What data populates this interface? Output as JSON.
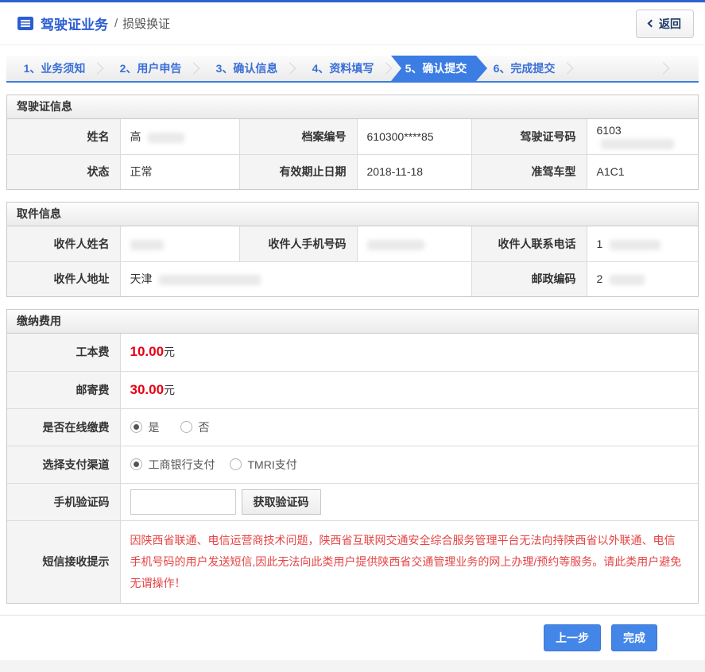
{
  "header": {
    "title": "驾驶证业务",
    "divider": "/",
    "subtitle": "损毁换证",
    "back_button": {
      "label": "返回"
    }
  },
  "steps": {
    "items": [
      {
        "label": "1、业务须知",
        "active": false
      },
      {
        "label": "2、用户申告",
        "active": false
      },
      {
        "label": "3、确认信息",
        "active": false
      },
      {
        "label": "4、资料填写",
        "active": false
      },
      {
        "label": "5、确认提交",
        "active": true
      },
      {
        "label": "6、完成提交",
        "active": false
      }
    ]
  },
  "license_section": {
    "title": "驾驶证信息",
    "fields": {
      "name": {
        "label": "姓名",
        "value": "高",
        "redacted": true
      },
      "file_no": {
        "label": "档案编号",
        "value": "610300****85",
        "redacted": false
      },
      "license_no": {
        "label": "驾驶证号码",
        "value": "6103",
        "redacted": true
      },
      "status": {
        "label": "状态",
        "value": "正常",
        "redacted": false
      },
      "valid_until": {
        "label": "有效期止日期",
        "value": "2018-11-18",
        "redacted": false
      },
      "vehicle_class": {
        "label": "准驾车型",
        "value": "A1C1",
        "redacted": false
      }
    }
  },
  "pickup_section": {
    "title": "取件信息",
    "fields": {
      "recipient_name": {
        "label": "收件人姓名",
        "value": "",
        "redacted": true
      },
      "recipient_mobile": {
        "label": "收件人手机号码",
        "value": "",
        "redacted": true
      },
      "recipient_phone": {
        "label": "收件人联系电话",
        "value": "1",
        "redacted": true
      },
      "recipient_address": {
        "label": "收件人地址",
        "value": "天津",
        "redacted": true
      },
      "postal_code": {
        "label": "邮政编码",
        "value": "2",
        "redacted": true
      }
    }
  },
  "payment_section": {
    "title": "缴纳费用",
    "fee_unit": "元",
    "rows": {
      "production_fee": {
        "label": "工本费",
        "amount": "10.00"
      },
      "postage_fee": {
        "label": "邮寄费",
        "amount": "30.00"
      },
      "online_payment": {
        "label": "是否在线缴费",
        "options": [
          {
            "label": "是",
            "selected": true
          },
          {
            "label": "否",
            "selected": false
          }
        ]
      },
      "payment_channel": {
        "label": "选择支付渠道",
        "options": [
          {
            "label": "工商银行支付",
            "selected": true
          },
          {
            "label": "TMRI支付",
            "selected": false
          }
        ]
      },
      "sms_code": {
        "label": "手机验证码",
        "input_value": "",
        "button_label": "获取验证码"
      },
      "sms_notice": {
        "label": "短信接收提示",
        "text": "因陕西省联通、电信运营商技术问题，陕西省互联网交通安全综合服务管理平台无法向持陕西省以外联通、电信手机号码的用户发送短信,因此无法向此类用户提供陕西省交通管理业务的网上办理/预约等服务。请此类用户避免无谓操作！"
      }
    }
  },
  "footer": {
    "prev_label": "上一步",
    "finish_label": "完成"
  },
  "colors": {
    "accent_blue": "#2b64cc",
    "active_step_blue": "#3b7de2",
    "button_blue": "#4486e8",
    "fee_red": "#e60012",
    "notice_red": "#e64545"
  }
}
